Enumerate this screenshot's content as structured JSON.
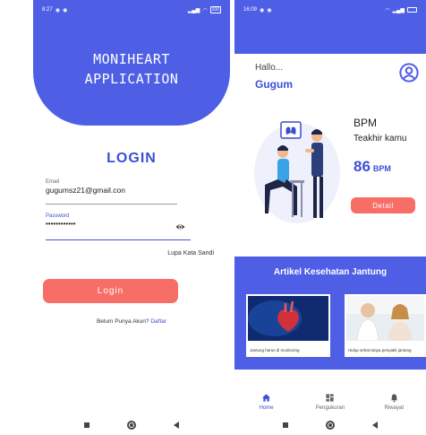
{
  "login_screen": {
    "status": {
      "time": "8:27",
      "battery": "100"
    },
    "app_title_line1": "MONIHEART",
    "app_title_line2": "APPLICATION",
    "title": "LOGIN",
    "email": {
      "label": "Email",
      "value": "gugumsz21@gmail.con"
    },
    "password": {
      "label": "Password",
      "value": "••••••••••••"
    },
    "forgot_label": "Lupa Kata Sandi",
    "login_label": "Login",
    "signup_prompt": "Belum Punya Akun?",
    "signup_link": "Daftar"
  },
  "home_screen": {
    "status": {
      "time": "16:09"
    },
    "greeting": "Hallo...",
    "user_name": "Gugum",
    "bpm_title": "BPM",
    "bpm_subtitle": "Teakhir kamu",
    "bpm_value": "86",
    "bpm_unit": "BPM",
    "detail_label": "Detail",
    "articles_title": "Artikel Kesehatan Jantung",
    "articles": [
      {
        "caption": "Jantung harus di monitoring"
      },
      {
        "caption": "Hidup sehat tanpa penyakit jantung"
      }
    ],
    "tabs": [
      {
        "label": "Home"
      },
      {
        "label": "Pengukuran"
      },
      {
        "label": "Riwayat"
      }
    ]
  },
  "colors": {
    "primary": "#4e5fe6",
    "accent": "#f76e66",
    "text_primary": "#3d4fd6"
  }
}
